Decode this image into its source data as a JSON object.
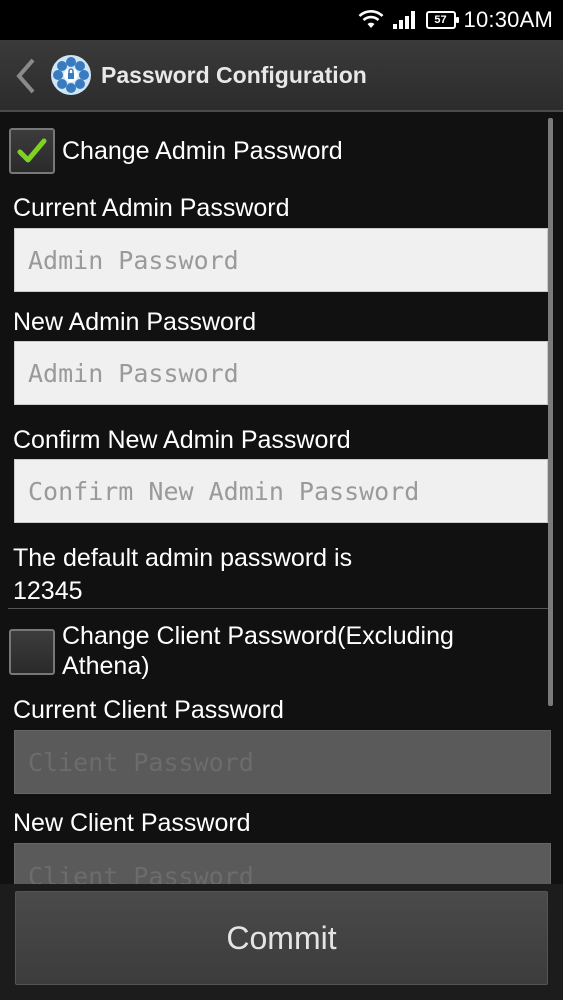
{
  "status_bar": {
    "time": "10:30AM",
    "battery_level": "57",
    "icons": [
      "wifi-icon",
      "signal-icon",
      "battery-icon"
    ]
  },
  "action_bar": {
    "title": "Password Configuration",
    "icons": [
      "back-icon",
      "app-icon"
    ]
  },
  "admin": {
    "checkbox_label": "Change Admin Password",
    "checked": true,
    "current_label": "Current Admin Password",
    "current_placeholder": "Admin Password",
    "new_label": "New Admin Password",
    "new_placeholder": "Admin Password",
    "confirm_label": "Confirm New Admin Password",
    "confirm_placeholder": "Confirm New Admin Password",
    "note_line1": "The default admin password is",
    "note_line2": "12345"
  },
  "client": {
    "checkbox_label_line1": "Change Client Password(Excluding",
    "checkbox_label_line2": "Athena)",
    "checked": false,
    "current_label": "Current Client Password",
    "current_placeholder": "Client Password",
    "new_label": "New Client Password",
    "new_placeholder": "Client Password"
  },
  "commit_label": "Commit",
  "colors": {
    "check_green": "#7ed321",
    "background": "#111111",
    "field_bg": "#f0f0f0"
  }
}
